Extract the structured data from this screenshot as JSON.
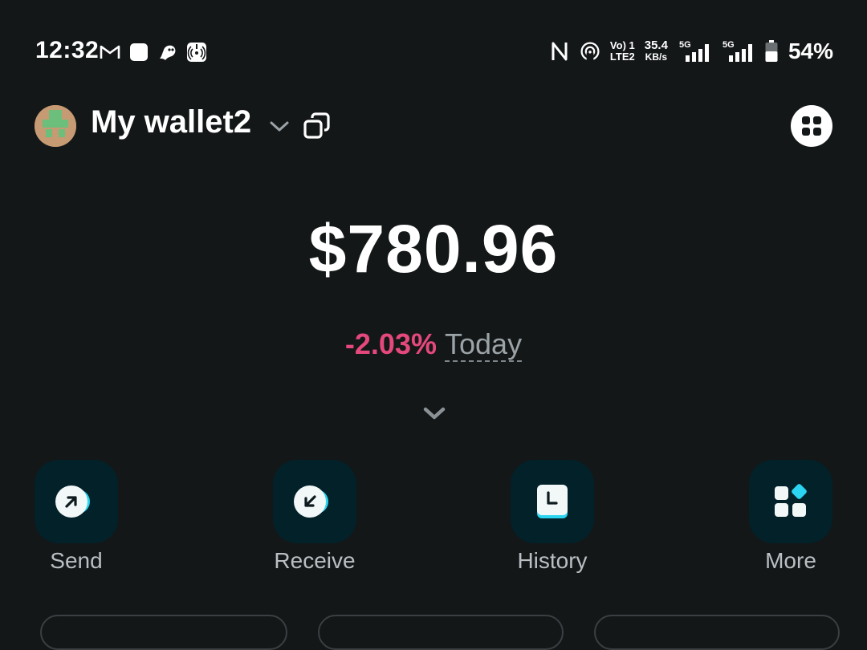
{
  "status_bar": {
    "time": "12:32",
    "net_label_top": "Vo) 1",
    "net_label_bottom": "LTE2",
    "speed_value": "35.4",
    "speed_unit": "KB/s",
    "sim1_label": "5G",
    "sim2_label": "5G",
    "battery": "54%",
    "battery_level": 0.54
  },
  "header": {
    "wallet_name": "My wallet2",
    "avatar_color": "#c69a72",
    "avatar_pattern_color": "#6cbf7a"
  },
  "balance": {
    "amount": "$780.96",
    "change": "-2.03%",
    "period": "Today",
    "change_color": "#e5487d"
  },
  "actions": [
    {
      "label": "Send",
      "icon": "send-arrow-icon"
    },
    {
      "label": "Receive",
      "icon": "receive-arrow-icon"
    },
    {
      "label": "History",
      "icon": "history-clock-icon"
    },
    {
      "label": "More",
      "icon": "more-grid-icon"
    }
  ],
  "colors": {
    "background": "#141718",
    "action_bg": "#022129",
    "accent": "#2bd4f0"
  }
}
